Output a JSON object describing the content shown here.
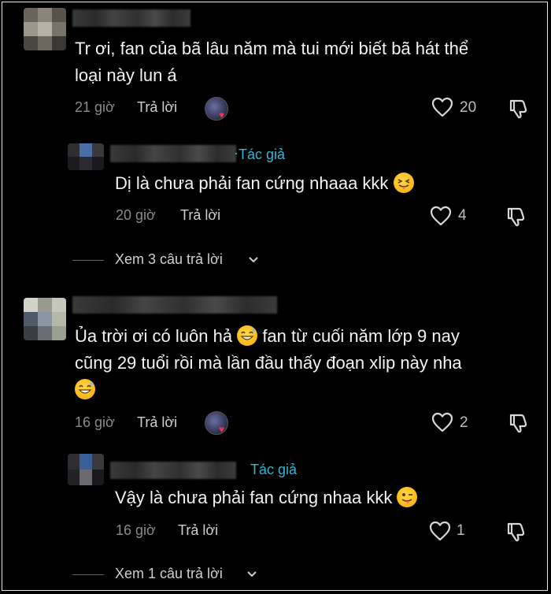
{
  "comments": [
    {
      "text_line1": "Tr ơi, fan của bã lâu năm mà tui mới biết bã hát thể",
      "text_line2": "loại này lun á",
      "time": "21 giờ",
      "reply_label": "Trả lời",
      "likes": "20",
      "reply": {
        "author_tag": "Tác giả",
        "text": "Dị là chưa phải fan cứng nhaaa kkk",
        "time": "20 giờ",
        "reply_label": "Trả lời",
        "likes": "4"
      },
      "view_more": "Xem 3 câu trả lời"
    },
    {
      "text_line1": "Ủa trời ơi có luôn hả",
      "text_line1b": "fan từ cuối năm lớp 9 nay",
      "text_line2": "cũng 29 tuổi rồi mà lần đầu thấy đoạn xlip này nha",
      "time": "16 giờ",
      "reply_label": "Trả lời",
      "likes": "2",
      "reply": {
        "author_tag": "Tác giả",
        "text": "Vậy là chưa phải fan cứng nhaa kkk",
        "time": "16 giờ",
        "reply_label": "Trả lời",
        "likes": "1"
      },
      "view_more": "Xem 1 câu trả lời"
    }
  ],
  "icons": {
    "like": "heart-outline-icon",
    "dislike": "thumbs-down-icon",
    "expand": "chevron-down-icon",
    "creator_like": "creator-liked-avatar-icon",
    "emoji_tongue": "squinting-tongue-emoji",
    "emoji_sweat": "grinning-sweat-emoji",
    "emoji_wink": "winking-tongue-emoji"
  },
  "colors": {
    "background": "#000000",
    "author_tag": "#2fb6d6",
    "heart_badge": "#ff2d55"
  }
}
